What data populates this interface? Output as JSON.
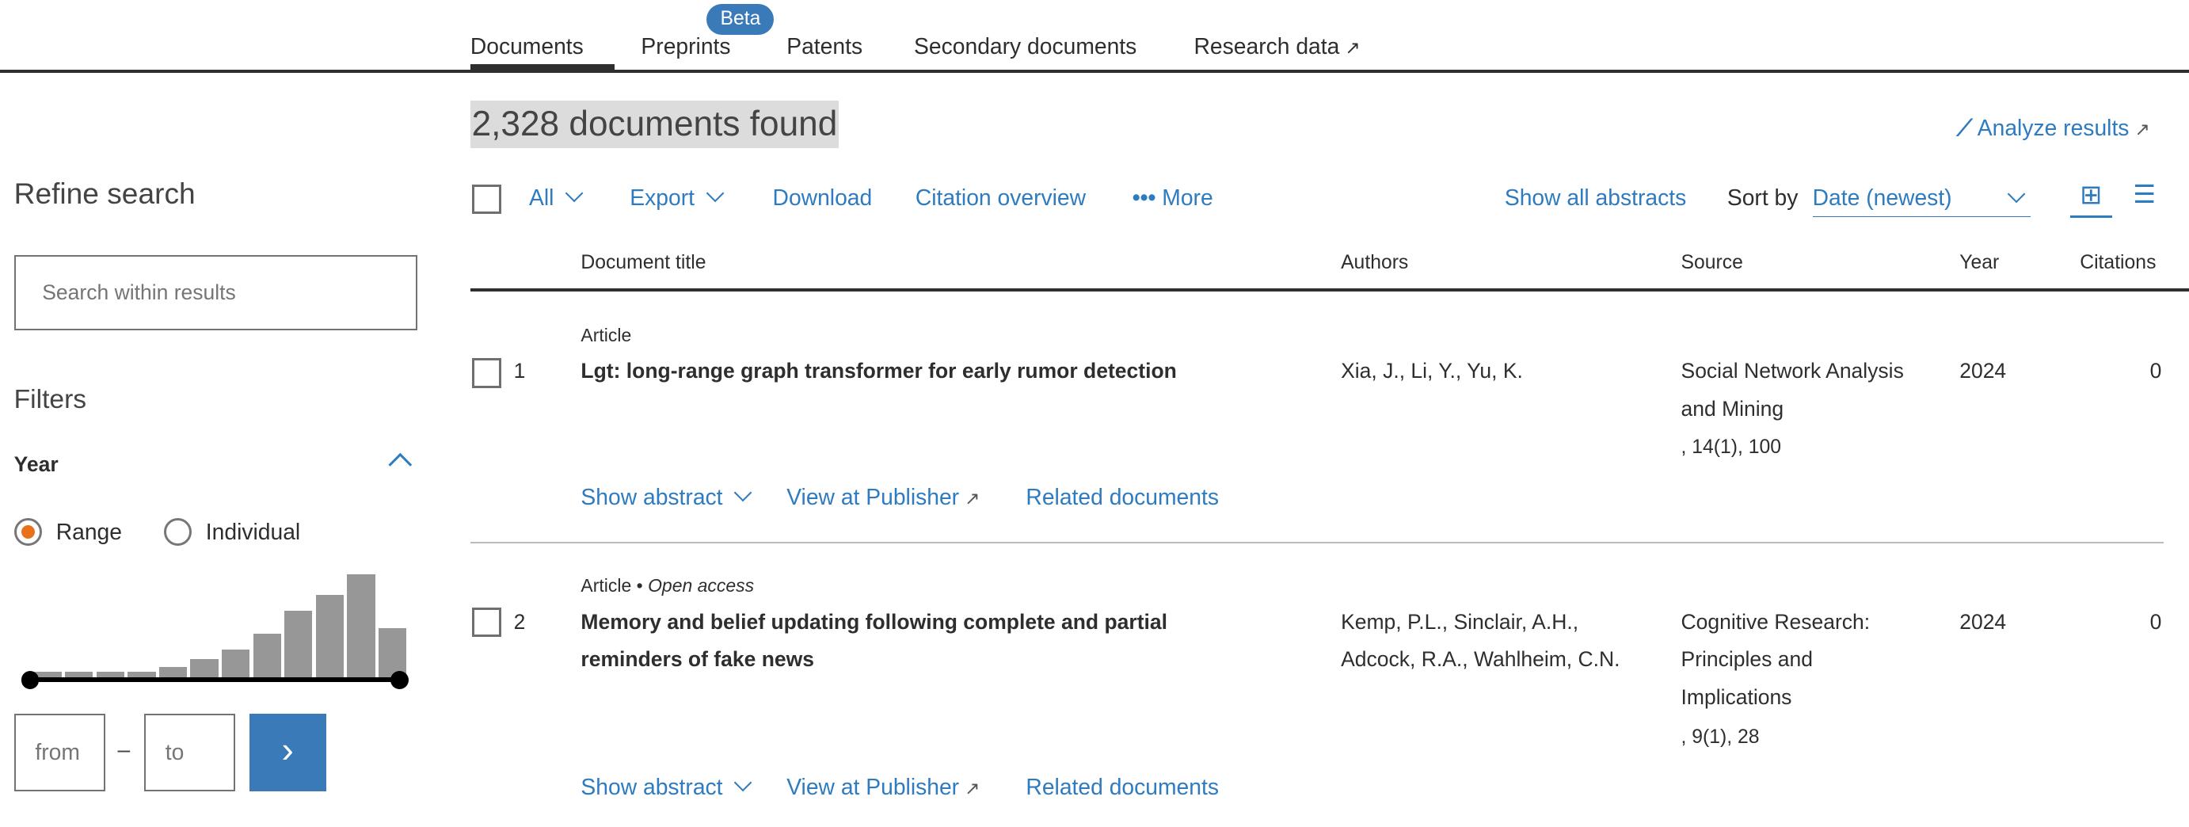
{
  "tabs": [
    {
      "label": "Documents",
      "active": true
    },
    {
      "label": "Preprints",
      "badge": "Beta"
    },
    {
      "label": "Patents"
    },
    {
      "label": "Secondary documents"
    },
    {
      "label": "Research data",
      "external": true
    }
  ],
  "results_count": "2,328 documents found",
  "analyze": "Analyze results",
  "toolbar": {
    "all": "All",
    "export": "Export",
    "download": "Download",
    "citation": "Citation overview",
    "more": "More",
    "show_abstracts": "Show all abstracts",
    "sort_label": "Sort by",
    "sort_value": "Date (newest)"
  },
  "columns": {
    "title": "Document title",
    "authors": "Authors",
    "source": "Source",
    "year": "Year",
    "citations": "Citations"
  },
  "rows": [
    {
      "num": "1",
      "type": "Article",
      "access": "",
      "title": "Lgt: long-range graph transformer for early rumor detection",
      "authors": "Xia, J., Li, Y., Yu, K.",
      "source": "Social Network Analysis and Mining",
      "source_detail": ", 14(1), 100",
      "year": "2024",
      "citations": "0"
    },
    {
      "num": "2",
      "type": "Article",
      "access": "Open access",
      "title": "Memory and belief updating following complete and partial reminders of fake news",
      "authors": "Kemp, P.L., Sinclair, A.H., Adcock, R.A., Wahlheim, C.N.",
      "source": "Cognitive Research: Principles and Implications",
      "source_detail": ", 9(1), 28",
      "year": "2024",
      "citations": "0"
    }
  ],
  "row_actions": {
    "show_abstract": "Show abstract",
    "view_publisher": "View at Publisher",
    "related": "Related documents"
  },
  "sidebar": {
    "refine": "Refine search",
    "search_placeholder": "Search within results",
    "filters": "Filters",
    "year": "Year",
    "range": "Range",
    "individual": "Individual",
    "from_placeholder": "from",
    "to_placeholder": "to",
    "dash": "–"
  },
  "chart_data": {
    "type": "bar",
    "title": "Year distribution",
    "values": [
      20,
      20,
      20,
      20,
      38,
      68,
      102,
      161,
      245,
      302,
      380,
      182
    ]
  },
  "colors": {
    "accent": "#2e7bbf",
    "radio": "#e9711c",
    "bar": "#979797"
  }
}
